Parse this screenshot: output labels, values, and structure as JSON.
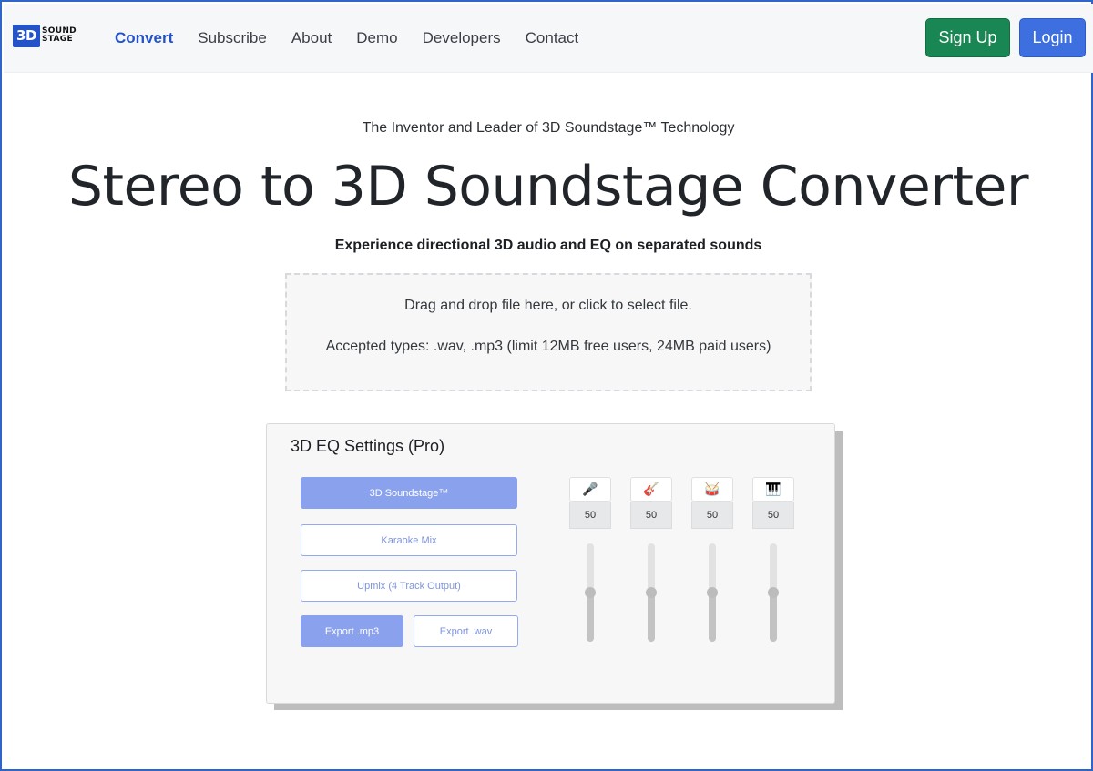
{
  "logo": {
    "badge": "3D",
    "line1": "SOUND",
    "line2": "STAGE"
  },
  "nav": {
    "links": [
      "Convert",
      "Subscribe",
      "About",
      "Demo",
      "Developers",
      "Contact"
    ],
    "active": "Convert",
    "signup_label": "Sign Up",
    "login_label": "Login"
  },
  "hero": {
    "tagline": "The Inventor and Leader of 3D Soundstage™ Technology",
    "headline": "Stereo to 3D Soundstage Converter",
    "subtitle": "Experience directional 3D audio and EQ on separated sounds"
  },
  "dropzone": {
    "instruction": "Drag and drop file here, or click to select file.",
    "accepted": "Accepted types: .wav, .mp3 (limit 12MB free users, 24MB paid users)"
  },
  "eq": {
    "title": "3D EQ Settings (Pro)",
    "modes": {
      "soundstage": "3D Soundstage™",
      "karaoke": "Karaoke Mix",
      "upmix": "Upmix (4 Track Output)"
    },
    "export": {
      "mp3": "Export .mp3",
      "wav": "Export .wav"
    },
    "tracks": [
      {
        "icon": "microphone-icon",
        "glyph": "🎤",
        "color": "#1fa83a",
        "value": "50",
        "level": 0.5
      },
      {
        "icon": "guitar-icon",
        "glyph": "🎸",
        "color": "#d23a2a",
        "value": "50",
        "level": 0.5
      },
      {
        "icon": "drum-icon",
        "glyph": "🥁",
        "color": "#e8a318",
        "value": "50",
        "level": 0.5
      },
      {
        "icon": "piano-icon",
        "glyph": "🎹",
        "color": "#222222",
        "value": "50",
        "level": 0.5
      }
    ]
  },
  "colors": {
    "brand": "#2453c9",
    "signup": "#198754",
    "login": "#3d6fe0",
    "accent_light": "#8aa2ee"
  }
}
